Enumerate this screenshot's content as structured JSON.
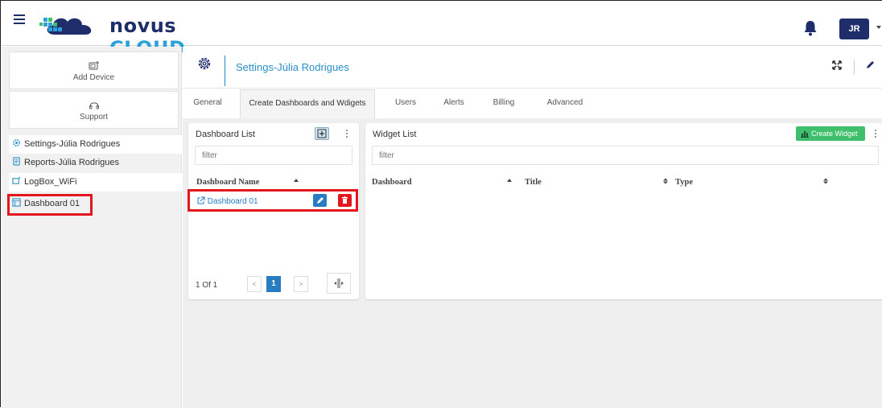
{
  "header": {
    "logo_main": "novus",
    "logo_accent": "CLOUD",
    "user_initials": "JR"
  },
  "sidebar": {
    "add_device": "Add Device",
    "support": "Support",
    "items": [
      {
        "label": "Settings-Júlia Rodrigues",
        "icon": "gear-icon"
      },
      {
        "label": "Reports-Júlia Rodrigues",
        "icon": "report-icon"
      },
      {
        "label": "LogBox_WiFi",
        "icon": "device-icon"
      },
      {
        "label": "Dashboard 01",
        "icon": "dashboard-icon"
      }
    ]
  },
  "settings": {
    "title": "Settings-Júlia Rodrigues",
    "tabs": [
      "General",
      "Create Dashboards and Wdigets",
      "Users",
      "Alerts",
      "Billing",
      "Advanced"
    ],
    "active_tab": "Create Dashboards and Wdigets"
  },
  "dashboard_list": {
    "title": "Dashboard List",
    "filter_placeholder": "filter",
    "column": "Dashboard Name",
    "rows": [
      "Dashboard 01"
    ],
    "page_info": "1 Of 1",
    "prev": "<",
    "page": "1",
    "next": ">"
  },
  "widget_list": {
    "title": "Widget List",
    "create_label": "Create Widget",
    "filter_placeholder": "filter",
    "columns": [
      "Dashboard",
      "Title",
      "Type"
    ]
  },
  "colors": {
    "brand_navy": "#1f2d6b",
    "brand_blue": "#2ca0d8",
    "link_blue": "#2a7cc0",
    "highlight_red": "#e3151d",
    "create_green": "#3fbf6b"
  }
}
